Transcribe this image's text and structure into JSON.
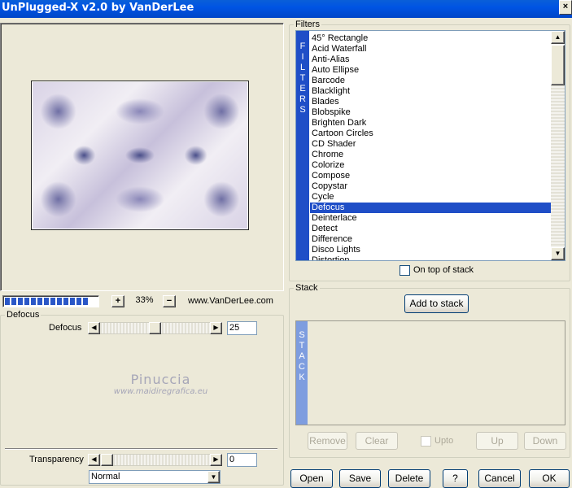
{
  "window": {
    "title": "UnPlugged-X v2.0 by VanDerLee",
    "close_glyph": "×"
  },
  "preview": {
    "progress_segments": 13,
    "zoom_minus": "−",
    "zoom_plus": "+",
    "zoom_value": "33%",
    "website": "www.VanDerLee.com"
  },
  "params": {
    "group_label": "Defocus",
    "defocus_label": "Defocus",
    "defocus_value": "25",
    "transparency_label": "Transparency",
    "transparency_value": "0",
    "blend_mode": "Normal"
  },
  "watermark": {
    "line1": "Pinuccia",
    "line2": "www.maidiregrafica.eu"
  },
  "filters": {
    "group_label": "Filters",
    "strip_letters": [
      "F",
      "I",
      "L",
      "T",
      "E",
      "R",
      "S"
    ],
    "items": [
      "45° Rectangle",
      "Acid Waterfall",
      "Anti-Alias",
      "Auto Ellipse",
      "Barcode",
      "Blacklight",
      "Blades",
      "Blobspike",
      "Brighten Dark",
      "Cartoon Circles",
      "CD Shader",
      "Chrome",
      "Colorize",
      "Compose",
      "Copystar",
      "Cycle",
      "Defocus",
      "Deinterlace",
      "Detect",
      "Difference",
      "Disco Lights",
      "Distortion"
    ],
    "selected": "Defocus",
    "on_top_label": "On top of stack"
  },
  "stack": {
    "group_label": "Stack",
    "add_label": "Add to stack",
    "strip_letters": [
      "S",
      "T",
      "A",
      "C",
      "K"
    ],
    "remove_label": "Remove",
    "clear_label": "Clear",
    "upto_label": "Upto",
    "up_label": "Up",
    "down_label": "Down"
  },
  "buttons": {
    "open": "Open",
    "save": "Save",
    "delete": "Delete",
    "help": "?",
    "cancel": "Cancel",
    "ok": "OK"
  }
}
